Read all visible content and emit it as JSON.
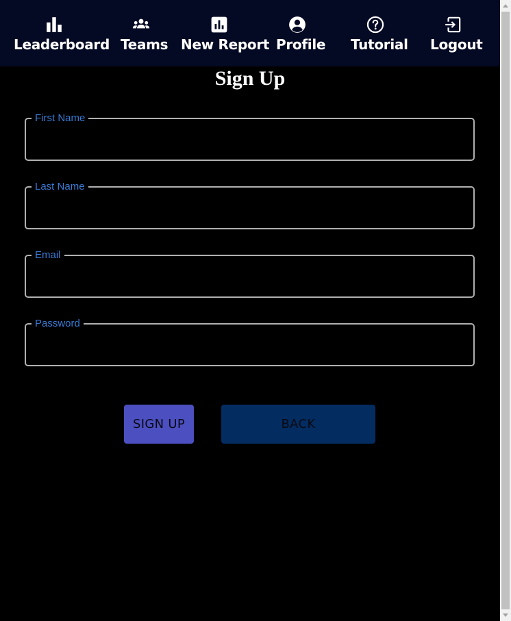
{
  "nav": {
    "items": [
      {
        "label": "Leaderboard",
        "icon": "leaderboard-icon"
      },
      {
        "label": "Teams",
        "icon": "groups-icon"
      },
      {
        "label": "New Report",
        "icon": "assessment-icon"
      },
      {
        "label": "Profile",
        "icon": "account-circle-icon"
      },
      {
        "label": "Tutorial",
        "icon": "help-circle-icon"
      },
      {
        "label": "Logout",
        "icon": "logout-icon"
      }
    ]
  },
  "page": {
    "title": "Sign Up"
  },
  "form": {
    "first_name": {
      "label": "First Name",
      "value": ""
    },
    "last_name": {
      "label": "Last Name",
      "value": ""
    },
    "email": {
      "label": "Email",
      "value": ""
    },
    "password": {
      "label": "Password",
      "value": ""
    }
  },
  "buttons": {
    "signup": "SIGN UP",
    "back": "BACK"
  },
  "colors": {
    "nav_background": "#050a24",
    "page_background": "#000000",
    "field_label": "#3a7bd5",
    "field_border": "#b0b0b0",
    "signup_button": "#4b4fc0",
    "back_button": "#032c61"
  }
}
